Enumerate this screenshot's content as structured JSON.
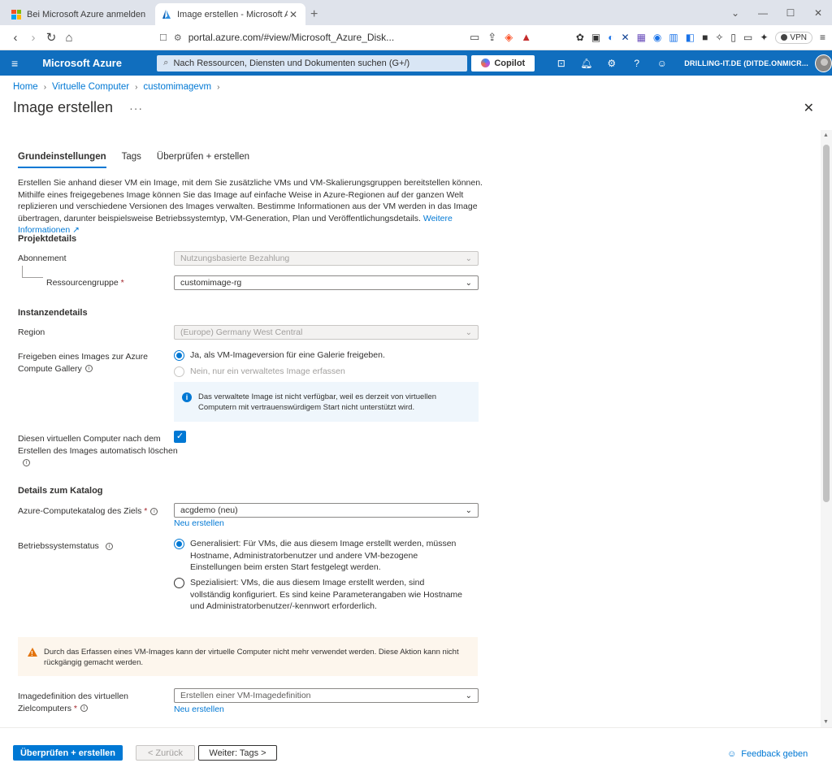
{
  "browser": {
    "tabs": [
      {
        "title": "Bei Microsoft Azure anmelden"
      },
      {
        "title": "Image erstellen - Microsoft Azure"
      }
    ],
    "url": "portal.azure.com/#view/Microsoft_Azure_Disk...",
    "vpn_label": "VPN"
  },
  "azure_header": {
    "brand": "Microsoft Azure",
    "search_placeholder": "Nach Ressourcen, Diensten und Dokumenten suchen (G+/)",
    "copilot_label": "Copilot",
    "account": "DRILLING-IT.DE (DITDE.ONMICR..."
  },
  "breadcrumb": [
    "Home",
    "Virtuelle Computer",
    "customimagevm"
  ],
  "page_title": "Image erstellen",
  "more_label": "···",
  "tabs": [
    "Grundeinstellungen",
    "Tags",
    "Überprüfen + erstellen"
  ],
  "description": {
    "text": "Erstellen Sie anhand dieser VM ein Image, mit dem Sie zusätzliche VMs und VM-Skalierungsgruppen bereitstellen können. Mithilfe eines freigegebenes Image können Sie das Image auf einfache Weise in Azure-Regionen auf der ganzen Welt replizieren und verschiedene Versionen des Images verwalten. Bestimme Informationen aus der VM werden in das Image übertragen, darunter beispielsweise Betriebssystemtyp, VM-Generation, Plan und Veröffentlichungsdetails.",
    "link": "Weitere Informationen"
  },
  "project": {
    "heading": "Projektdetails",
    "subscription_label": "Abonnement",
    "subscription_value": "Nutzungsbasierte Bezahlung",
    "rg_label": "Ressourcengruppe",
    "rg_value": "customimage-rg"
  },
  "instance": {
    "heading": "Instanzendetails",
    "region_label": "Region",
    "region_value": "(Europe) Germany West Central",
    "share_label_1": "Freigeben eines Images zur Azure",
    "share_label_2": "Compute Gallery",
    "share_options": [
      "Ja, als VM-Imageversion für eine Galerie freigeben.",
      "Nein, nur ein verwaltetes Image erfassen"
    ],
    "info_text": "Das verwaltete Image ist nicht verfügbar, weil es derzeit von virtuellen Computern mit vertrauenswürdigem Start nicht unterstützt wird.",
    "delete_label_1": "Diesen virtuellen Computer nach dem",
    "delete_label_2": "Erstellen des Images automatisch löschen",
    "delete_checked": true
  },
  "gallery": {
    "heading": "Details zum Katalog",
    "gallery_label": "Azure-Computekatalog des Ziels",
    "gallery_value": "acgdemo (neu)",
    "new_link": "Neu erstellen",
    "os_state_label": "Betriebssystemstatus",
    "os_options": [
      "Generalisiert: Für VMs, die aus diesem Image erstellt werden, müssen Hostname, Administratorbenutzer und andere VM-bezogene Einstellungen beim ersten Start festgelegt werden.",
      "Spezialisiert: VMs, die aus diesem Image erstellt werden, sind vollständig konfiguriert. Es sind keine Parameterangaben wie Hostname und Administratorbenutzer/-kennwort erforderlich."
    ],
    "warning_text": "Durch das Erfassen eines VM-Images kann der virtuelle Computer nicht mehr verwendet werden. Diese Aktion kann nicht rückgängig gemacht werden.",
    "imgdef_label_1": "Imagedefinition des virtuellen",
    "imgdef_label_2": "Zielcomputers",
    "imgdef_placeholder": "Erstellen einer VM-Imagedefinition",
    "imgdef_new_link": "Neu erstellen"
  },
  "footer": {
    "review_create": "Überprüfen + erstellen",
    "back": "< Zurück",
    "next": "Weiter: Tags >",
    "feedback": "Feedback geben"
  },
  "colors": {
    "azure_blue": "#0078d4",
    "header_blue": "#106ebe"
  }
}
